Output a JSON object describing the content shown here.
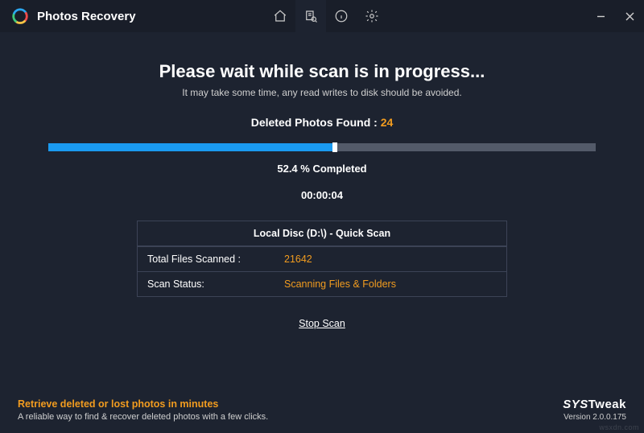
{
  "app_title": "Photos Recovery",
  "main": {
    "heading": "Please wait while scan is in progress...",
    "subheading": "It may take some time, any read writes to disk should be avoided.",
    "found_label": "Deleted Photos Found :",
    "found_count": "24",
    "progress_percent": 52.4,
    "percent_text": "52.4 % Completed",
    "elapsed": "00:00:04"
  },
  "info": {
    "header": "Local Disc (D:\\) - Quick Scan",
    "rows": [
      {
        "label": "Total Files Scanned :",
        "value": "21642"
      },
      {
        "label": "Scan Status:",
        "value": "Scanning Files & Folders"
      }
    ]
  },
  "actions": {
    "stop_label": "Stop Scan"
  },
  "footer": {
    "tagline_title": "Retrieve deleted or lost photos in minutes",
    "tagline_sub": "A reliable way to find & recover deleted photos with a few clicks.",
    "brand_prefix": "SYS",
    "brand_suffix": "Tweak",
    "version": "Version 2.0.0.175"
  },
  "watermark": "wsxdn.com"
}
